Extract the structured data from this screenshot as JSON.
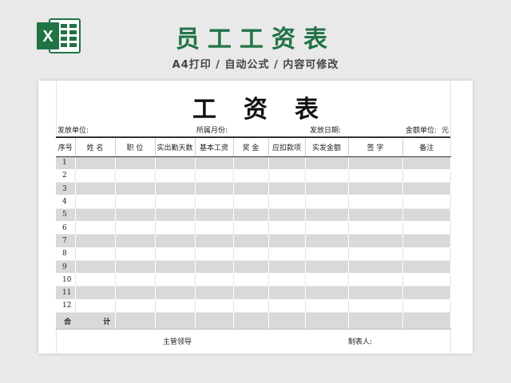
{
  "banner": {
    "logo_icon": "excel-logo-icon",
    "logo_letter": "X",
    "brand_color": "#217346",
    "title": "员工工资表",
    "subtitle": "A4打印 / 自动公式 / 内容可修改"
  },
  "sheet": {
    "title": "工资表",
    "info": {
      "issuer_label": "发放单位:",
      "month_label": "所属月份:",
      "date_label": "发放日期:",
      "unit_label": "金额单位:",
      "unit_value": "元"
    },
    "columns": [
      "序号",
      "姓  名",
      "职  位",
      "实出勤天数",
      "基本工资",
      "奖  金",
      "应扣款项",
      "实发金额",
      "签  字",
      "备注"
    ],
    "rows": [
      "1",
      "2",
      "3",
      "4",
      "5",
      "6",
      "7",
      "8",
      "9",
      "10",
      "11",
      "12"
    ],
    "total": {
      "label_left": "合",
      "label_right": "计"
    },
    "footer": {
      "supervisor_label": "主管领导",
      "preparer_label": "制表人:"
    }
  }
}
